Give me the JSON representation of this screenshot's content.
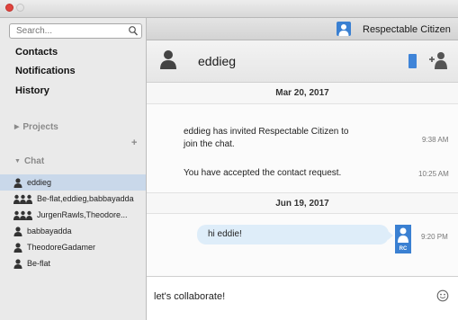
{
  "sidebar": {
    "search_placeholder": "Search...",
    "nav": [
      "Contacts",
      "Notifications",
      "History"
    ],
    "projects_label": "Projects",
    "chat_label": "Chat",
    "chats": [
      {
        "label": "eddieg",
        "kind": "single",
        "selected": true
      },
      {
        "label": "Be-flat,eddieg,babbayadda",
        "kind": "group",
        "selected": false
      },
      {
        "label": "JurgenRawls,Theodore...",
        "kind": "group",
        "selected": false
      },
      {
        "label": "babbayadda",
        "kind": "single",
        "selected": false
      },
      {
        "label": "TheodoreGadamer",
        "kind": "single",
        "selected": false
      },
      {
        "label": "Be-flat",
        "kind": "single",
        "selected": false
      }
    ]
  },
  "user": {
    "name": "Respectable Citizen",
    "initials": "RC",
    "avatar_color": "#3a80d2"
  },
  "chat": {
    "contact": "eddieg",
    "messages": [
      {
        "type": "date",
        "text": "Mar 20, 2017"
      },
      {
        "type": "system",
        "text_line1": "eddieg has invited Respectable Citizen to",
        "text_line2": "join the chat.",
        "time": "9:38 AM"
      },
      {
        "type": "system",
        "text": "You have accepted the contact request.",
        "time": "10:25 AM"
      },
      {
        "type": "date",
        "text": "Jun 19, 2017"
      },
      {
        "type": "outgoing",
        "text": "hi eddie!",
        "time": "9:20 PM"
      }
    ],
    "composer_value": "let's collaborate!"
  },
  "colors": {
    "accent": "#3a80d2",
    "selection": "#c9d8ea",
    "bubble": "#deedf9"
  },
  "icons": [
    "search-icon",
    "person-icon",
    "group-icon",
    "add-icon",
    "phone-icon",
    "add-contact-icon",
    "emoji-icon"
  ]
}
